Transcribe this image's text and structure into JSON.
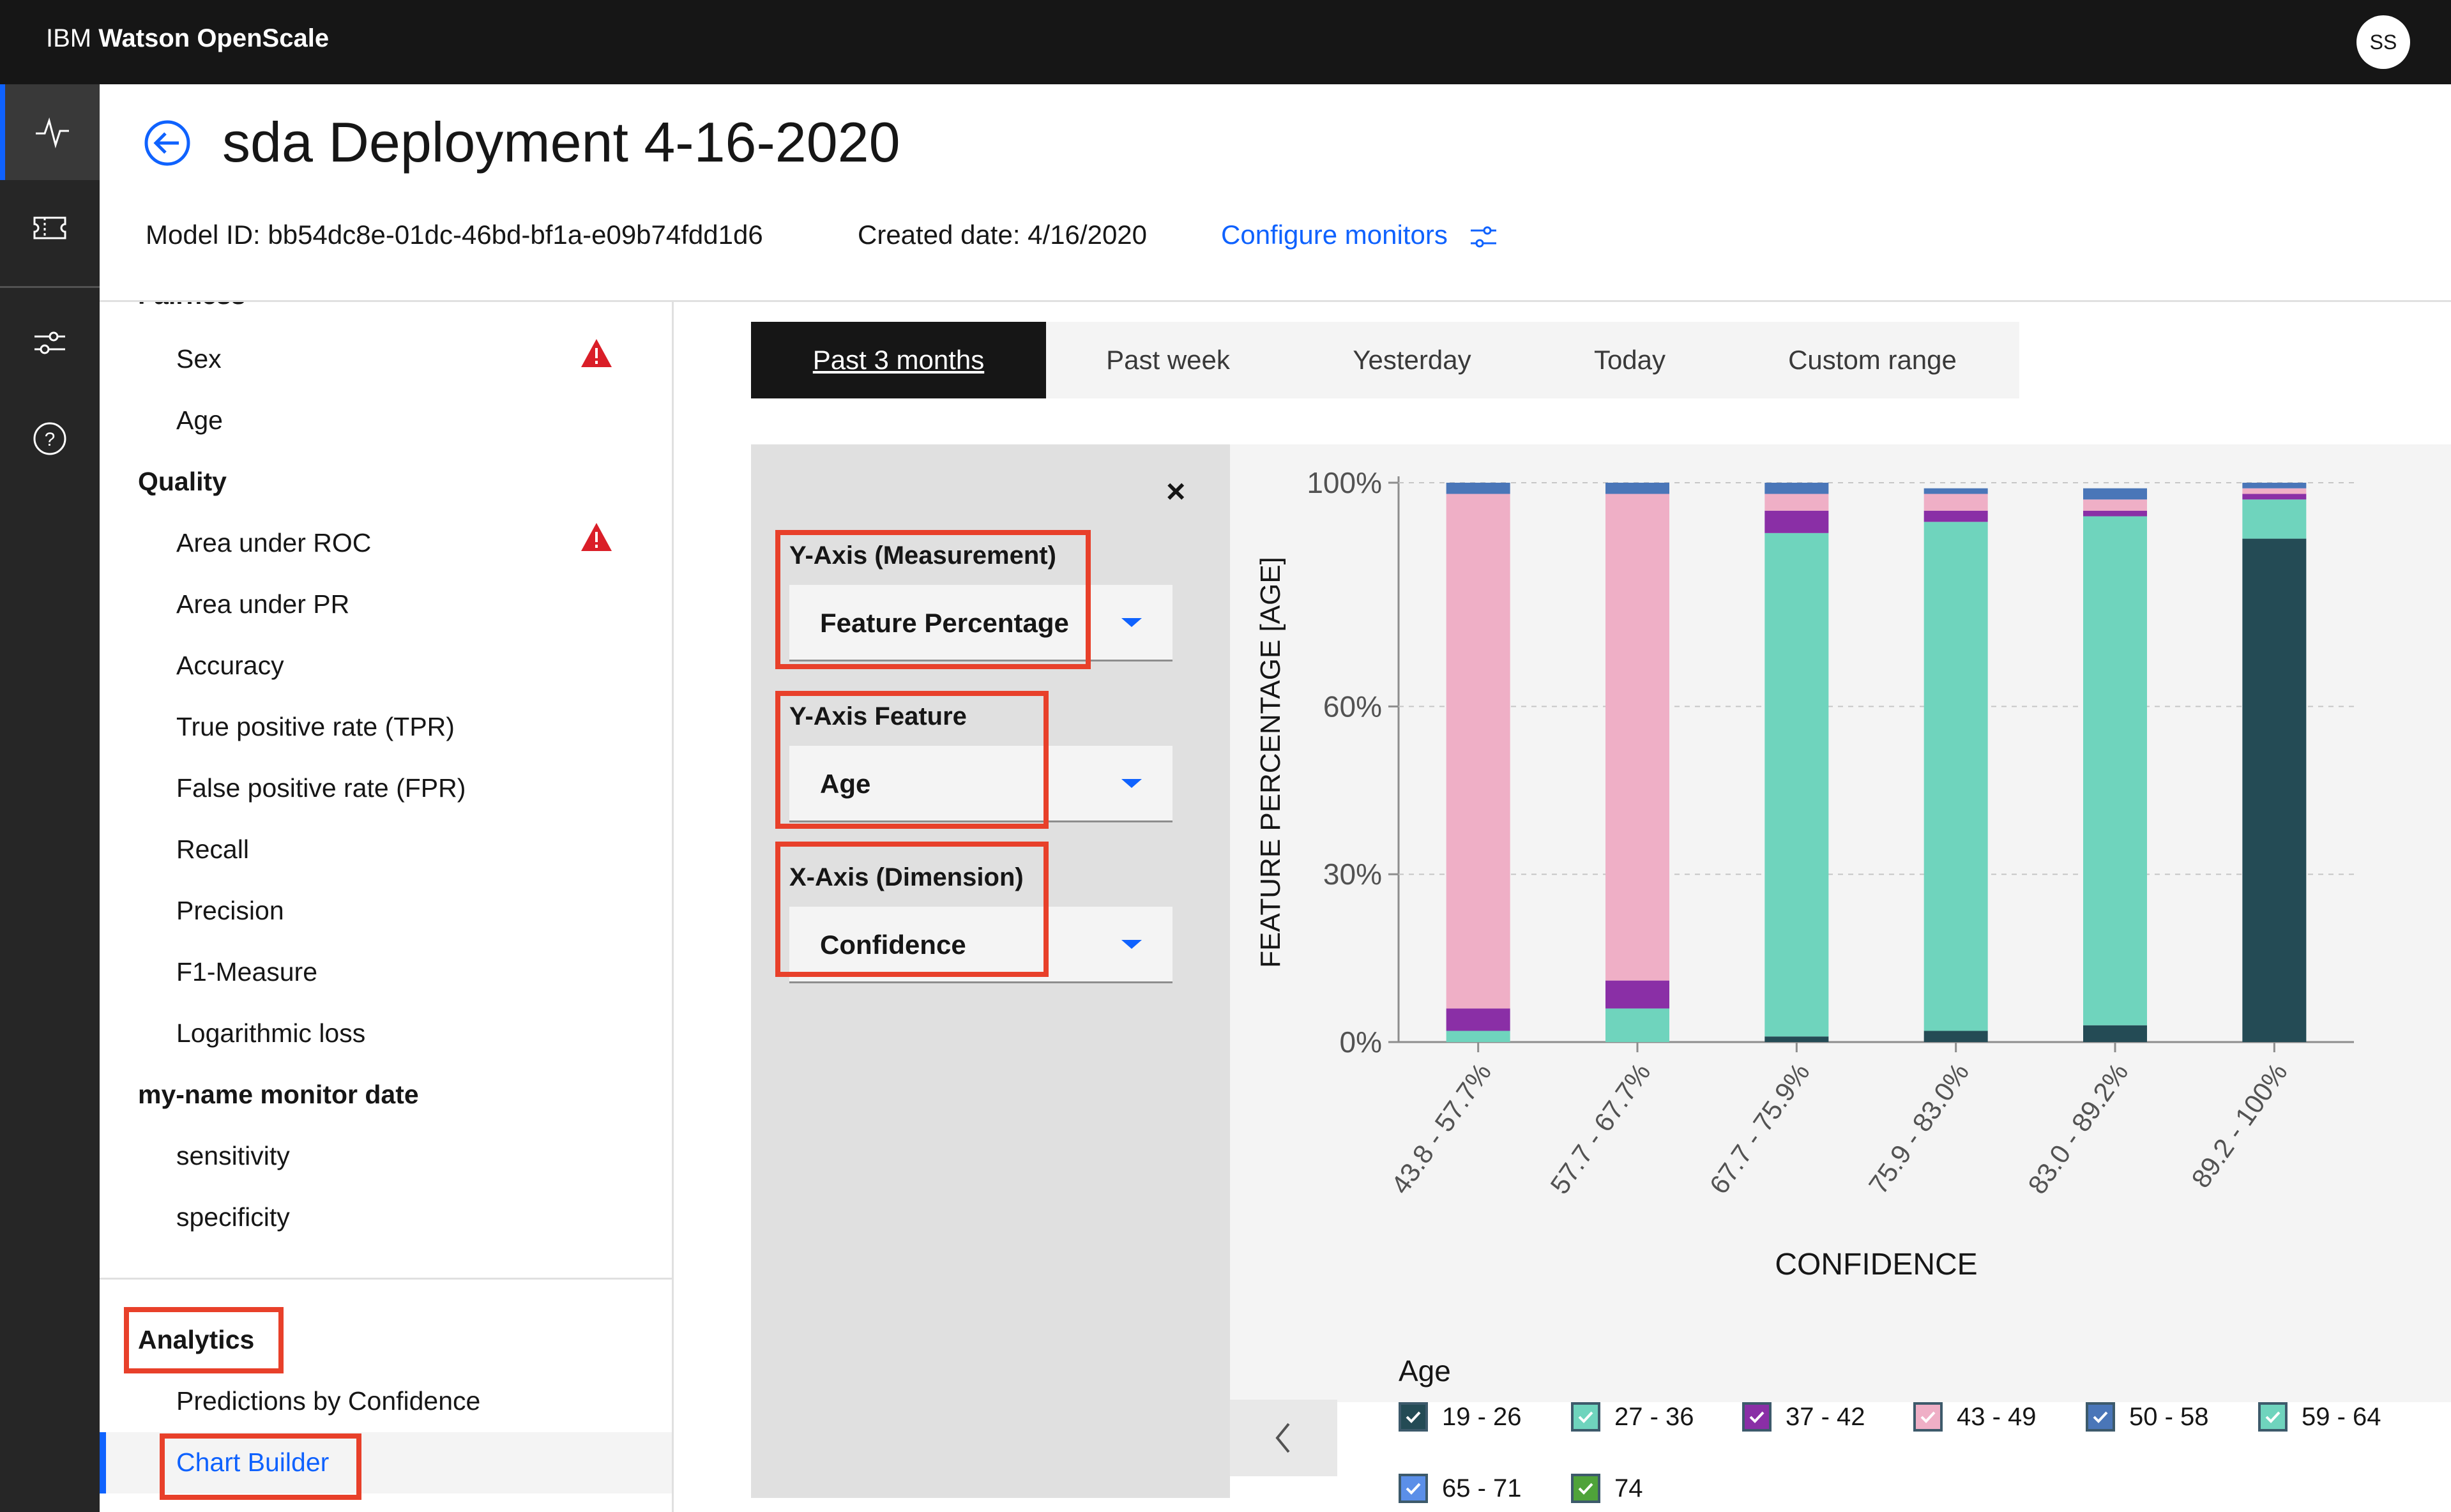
{
  "app": {
    "brand": "IBM",
    "product": "Watson OpenScale",
    "user_initials": "SS"
  },
  "header": {
    "title": "sda Deployment 4-16-2020",
    "model_id": "Model ID: bb54dc8e-01dc-46bd-bf1a-e09b74fdd1d6",
    "created": "Created date: 4/16/2020",
    "configure": "Configure monitors"
  },
  "nav": {
    "partial_head": "Fairness",
    "fairness_items": [
      "Sex",
      "Age"
    ],
    "quality_head": "Quality",
    "quality_items": [
      "Area under ROC",
      "Area under PR",
      "Accuracy",
      "True positive rate (TPR)",
      "False positive rate (FPR)",
      "Recall",
      "Precision",
      "F1-Measure",
      "Logarithmic loss"
    ],
    "custom_head": "my-name monitor date",
    "custom_items": [
      "sensitivity",
      "specificity"
    ],
    "analytics_head": "Analytics",
    "analytics_items": [
      "Predictions by Confidence",
      "Chart Builder"
    ]
  },
  "time_tabs": [
    "Past 3 months",
    "Past week",
    "Yesterday",
    "Today",
    "Custom range"
  ],
  "panel": {
    "y_measure_label": "Y-Axis (Measurement)",
    "y_measure_value": "Feature Percentage",
    "y_feature_label": "Y-Axis Feature",
    "y_feature_value": "Age",
    "x_dim_label": "X-Axis (Dimension)",
    "x_dim_value": "Confidence"
  },
  "colors": {
    "c19_26": "#244b55",
    "c27_36": "#6fd4bd",
    "c37_42": "#8a2fa6",
    "c43_49": "#efafc6",
    "c50_58": "#4a76b8",
    "c59_64": "#6fd4bd",
    "c65_71": "#5b8fe8",
    "c74": "#4fa33a",
    "warning": "#da1e28",
    "accent": "#0f62fe",
    "highlight_box": "#e8402a"
  },
  "chart_data": {
    "type": "bar",
    "stacked": true,
    "xlabel": "CONFIDENCE",
    "ylabel": "FEATURE PERCENTAGE [AGE]",
    "ylim": [
      0,
      100
    ],
    "yticks": [
      "0%",
      "30%",
      "60%",
      "100%"
    ],
    "categories": [
      "43.8 - 57.7%",
      "57.7 - 67.7%",
      "67.7 - 75.9%",
      "75.9 - 83.0%",
      "83.0 - 89.2%",
      "89.2 - 100%"
    ],
    "legend_title": "Age",
    "series": [
      {
        "name": "19 - 26",
        "color": "#244b55",
        "values": [
          0,
          0,
          1,
          2,
          3,
          90
        ]
      },
      {
        "name": "27 - 36",
        "color": "#6fd4bd",
        "values": [
          2,
          6,
          90,
          91,
          91,
          7
        ]
      },
      {
        "name": "37 - 42",
        "color": "#8a2fa6",
        "values": [
          4,
          5,
          4,
          2,
          1,
          1
        ]
      },
      {
        "name": "43 - 49",
        "color": "#efafc6",
        "values": [
          92,
          87,
          3,
          3,
          2,
          1
        ]
      },
      {
        "name": "50 - 58",
        "color": "#4a76b8",
        "values": [
          2,
          2,
          2,
          1,
          2,
          1
        ]
      }
    ],
    "legend": [
      {
        "name": "19 - 26",
        "color": "#244b55"
      },
      {
        "name": "27 - 36",
        "color": "#6fd4bd"
      },
      {
        "name": "37 - 42",
        "color": "#8a2fa6"
      },
      {
        "name": "43 - 49",
        "color": "#efafc6"
      },
      {
        "name": "50 - 58",
        "color": "#4a76b8"
      },
      {
        "name": "59 - 64",
        "color": "#6fd4bd"
      },
      {
        "name": "65 - 71",
        "color": "#5b8fe8"
      },
      {
        "name": "74",
        "color": "#4fa33a"
      }
    ]
  }
}
